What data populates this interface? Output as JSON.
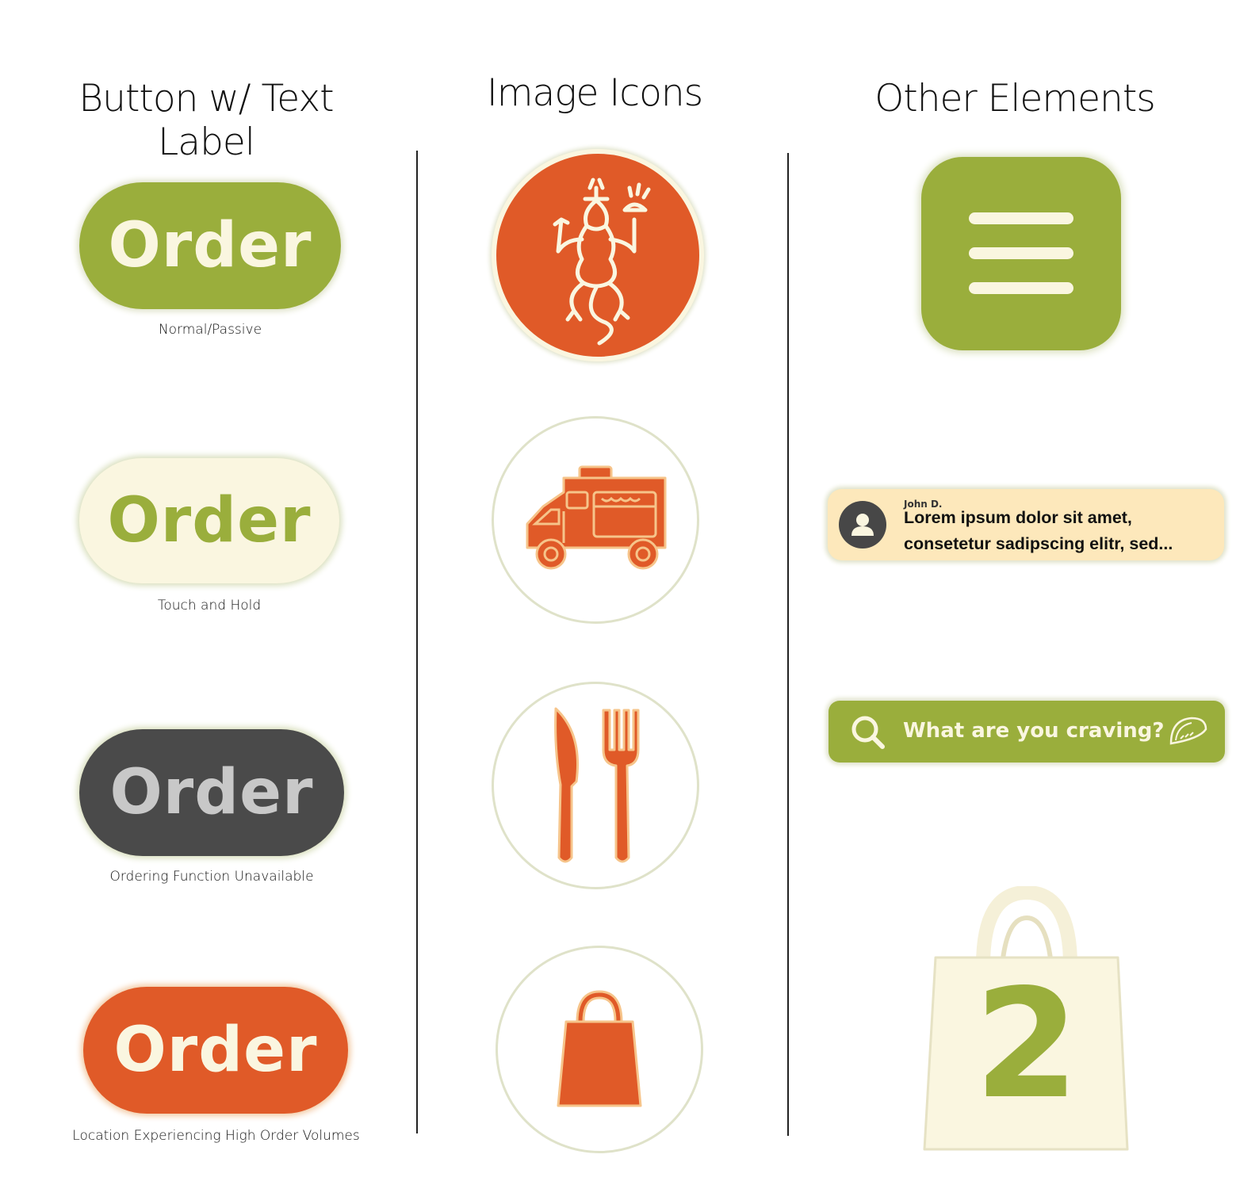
{
  "columns": {
    "buttons_title": "Button w/ Text Label",
    "icons_title": "Image Icons",
    "other_title": "Other Elements"
  },
  "buttons": [
    {
      "label": "Order",
      "caption": "Normal/Passive",
      "bg": "#9aae3c",
      "fg": "#faf6e0"
    },
    {
      "label": "Order",
      "caption": "Touch and Hold",
      "bg": "#faf6e0",
      "fg": "#9aae3c"
    },
    {
      "label": "Order",
      "caption": "Ordering Function Unavailable",
      "bg": "#4a4a4a",
      "fg": "#c8c8c8"
    },
    {
      "label": "Order",
      "caption": "Location Experiencing High Order Volumes",
      "bg": "#e05a28",
      "fg": "#faf6e0"
    }
  ],
  "icons": [
    {
      "name": "lizard-mascot-icon"
    },
    {
      "name": "food-truck-icon"
    },
    {
      "name": "knife-fork-icon"
    },
    {
      "name": "shopping-bag-icon"
    }
  ],
  "other": {
    "menu_icon": "hamburger-menu-icon",
    "review": {
      "author": "John D.",
      "line1": "Lorem ipsum dolor sit amet,",
      "line2": "consetetur sadipscing elitr, sed..."
    },
    "search": {
      "placeholder": "What are you craving?"
    },
    "cart": {
      "count": "2"
    }
  },
  "colors": {
    "green": "#9aae3c",
    "cream": "#faf6e0",
    "orange": "#e05a28",
    "gray": "#4a4a4a",
    "review_bg": "#fde8bb"
  }
}
